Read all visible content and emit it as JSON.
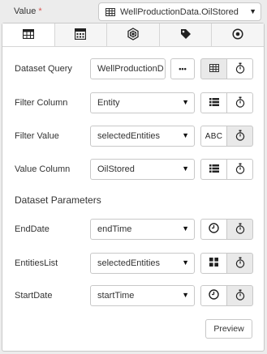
{
  "field": {
    "label": "Value",
    "required_mark": "*",
    "selected_value": "WellProductionData.OilStored"
  },
  "tabs": [
    {
      "icon": "table-icon",
      "active": true
    },
    {
      "icon": "calculator-icon",
      "active": false
    },
    {
      "icon": "hexagon-graph-icon",
      "active": false
    },
    {
      "icon": "tag-icon",
      "active": false
    },
    {
      "icon": "target-icon",
      "active": false
    }
  ],
  "dataset_query": {
    "label": "Dataset Query",
    "value": "WellProductionD",
    "more_label": "•••"
  },
  "filter_column": {
    "label": "Filter Column",
    "value": "Entity"
  },
  "filter_value": {
    "label": "Filter Value",
    "value": "selectedEntities",
    "abc_label": "ABC"
  },
  "value_column": {
    "label": "Value Column",
    "value": "OilStored"
  },
  "dataset_parameters": {
    "title": "Dataset Parameters",
    "params": [
      {
        "label": "EndDate",
        "value": "endTime",
        "type_icon": "clock-icon"
      },
      {
        "label": "EntitiesList",
        "value": "selectedEntities",
        "type_icon": "grid-icon"
      },
      {
        "label": "StartDate",
        "value": "startTime",
        "type_icon": "clock-icon"
      }
    ]
  },
  "preview_button": "Preview"
}
